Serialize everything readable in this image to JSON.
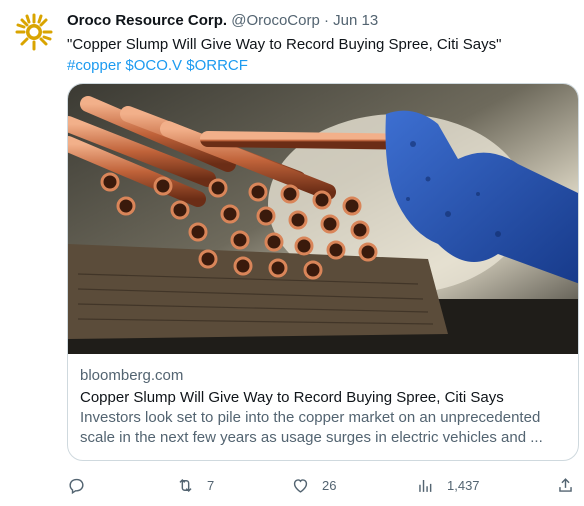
{
  "tweet": {
    "author_name": "Oroco Resource Corp.",
    "handle": "@OrocoCorp",
    "separator": "·",
    "date": "Jun 13",
    "text": "\"Copper Slump Will Give Way to Record Buying Spree, Citi Says\"",
    "hashtags": "#copper $OCO.V $ORRCF"
  },
  "card": {
    "domain": "bloomberg.com",
    "title": "Copper Slump Will Give Way to Record Buying Spree, Citi Says",
    "description_line1": "Investors look set to pile into the copper market on an unprecedented",
    "description_line2": "scale in the next few years as usage surges in electric vehicles and ..."
  },
  "actions": {
    "reply_icon": "reply-icon",
    "retweet_icon": "retweet-icon",
    "retweets": "7",
    "like_icon": "heart-icon",
    "likes": "26",
    "views_icon": "views-icon",
    "views": "1,437",
    "share_icon": "share-icon"
  },
  "colors": {
    "link": "#1d9bf0",
    "secondary": "#536471",
    "primary": "#0f1419",
    "logo_gold": "#d9a400"
  }
}
